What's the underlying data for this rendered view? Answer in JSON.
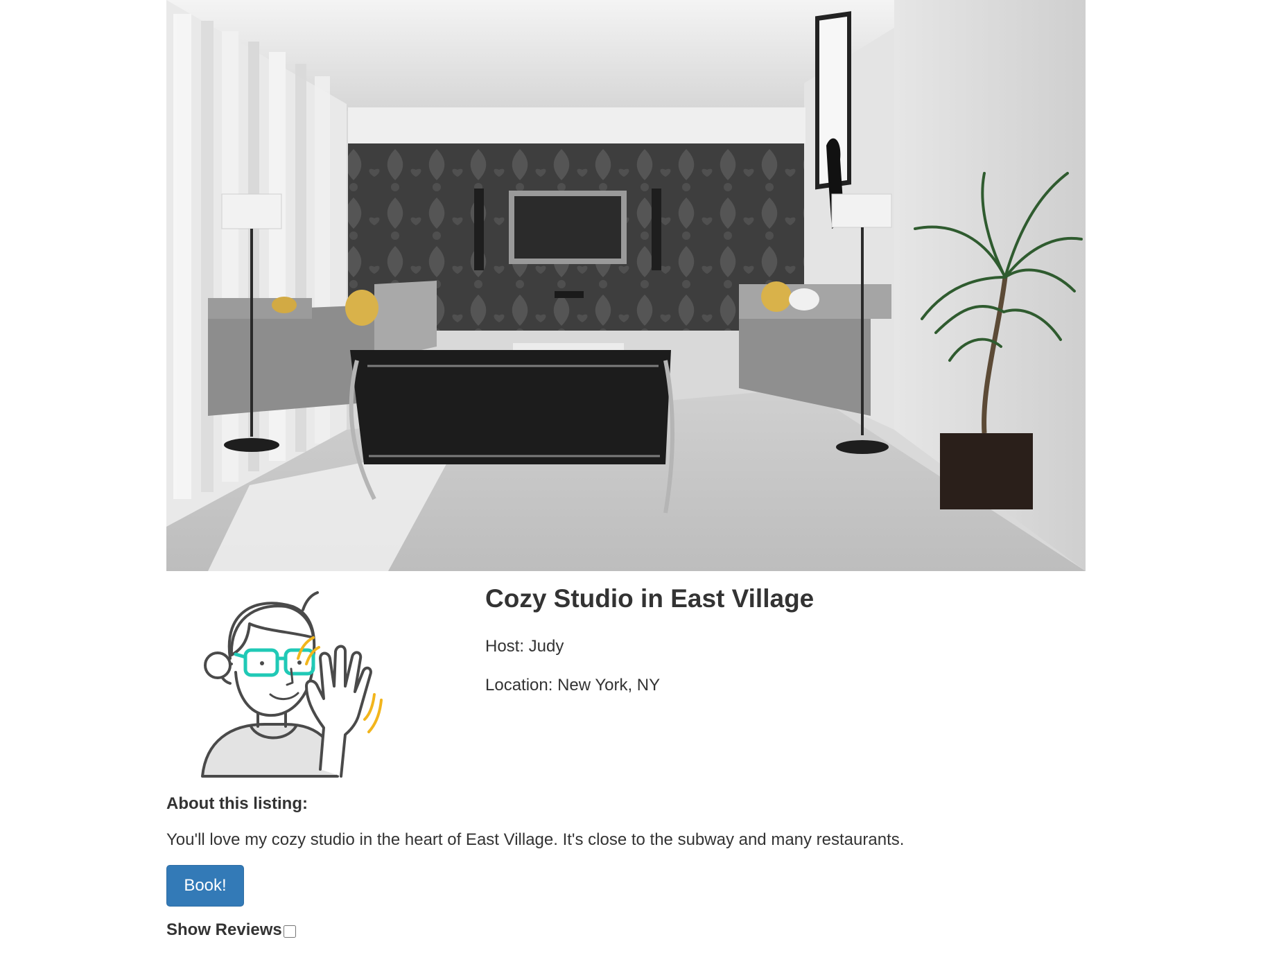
{
  "listing": {
    "title": "Cozy Studio in East Village",
    "host_line": "Host: Judy",
    "location_line": "Location: New York, NY",
    "about_heading": "About this listing:",
    "about_text": "You'll love my cozy studio in the heart of East Village. It's close to the subway and many restaurants."
  },
  "actions": {
    "book_label": "Book!",
    "show_reviews_label": "Show Reviews",
    "show_reviews_checked": false
  },
  "colors": {
    "primary_button": "#337ab7",
    "text": "#333333",
    "avatar_glasses": "#20c9b6",
    "avatar_wave": "#f2b51c"
  },
  "images": {
    "hero": "living-room-photo",
    "avatar": "waving-host-illustration"
  }
}
